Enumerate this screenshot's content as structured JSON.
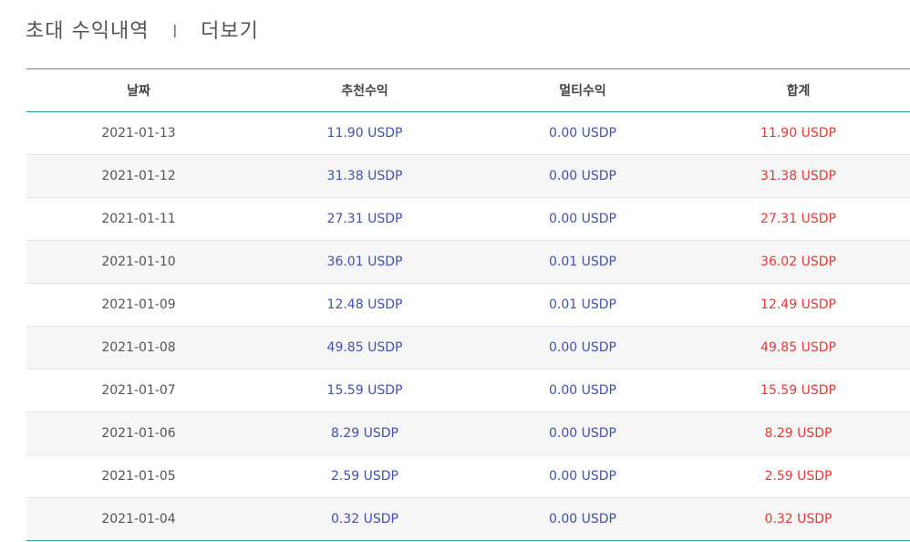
{
  "header": {
    "title": "초대 수익내역",
    "separator": "|",
    "more_link": "더보기"
  },
  "table": {
    "columns": [
      "날짜",
      "추천수익",
      "멀티수익",
      "합계"
    ],
    "rows": [
      {
        "date": "2021-01-13",
        "rec": "11.90 USDP",
        "multi": "0.00 USDP",
        "total": "11.90 USDP"
      },
      {
        "date": "2021-01-12",
        "rec": "31.38 USDP",
        "multi": "0.00 USDP",
        "total": "31.38 USDP"
      },
      {
        "date": "2021-01-11",
        "rec": "27.31 USDP",
        "multi": "0.00 USDP",
        "total": "27.31 USDP"
      },
      {
        "date": "2021-01-10",
        "rec": "36.01 USDP",
        "multi": "0.01 USDP",
        "total": "36.02 USDP"
      },
      {
        "date": "2021-01-09",
        "rec": "12.48 USDP",
        "multi": "0.01 USDP",
        "total": "12.49 USDP"
      },
      {
        "date": "2021-01-08",
        "rec": "49.85 USDP",
        "multi": "0.00 USDP",
        "total": "49.85 USDP"
      },
      {
        "date": "2021-01-07",
        "rec": "15.59 USDP",
        "multi": "0.00 USDP",
        "total": "15.59 USDP"
      },
      {
        "date": "2021-01-06",
        "rec": "8.29 USDP",
        "multi": "0.00 USDP",
        "total": "8.29 USDP"
      },
      {
        "date": "2021-01-05",
        "rec": "2.59 USDP",
        "multi": "0.00 USDP",
        "total": "2.59 USDP"
      },
      {
        "date": "2021-01-04",
        "rec": "0.32 USDP",
        "multi": "0.00 USDP",
        "total": "0.32 USDP"
      }
    ]
  },
  "colors": {
    "accent_border": "#26a69a",
    "income_blue": "#3f51b5",
    "total_red": "#e53935"
  }
}
